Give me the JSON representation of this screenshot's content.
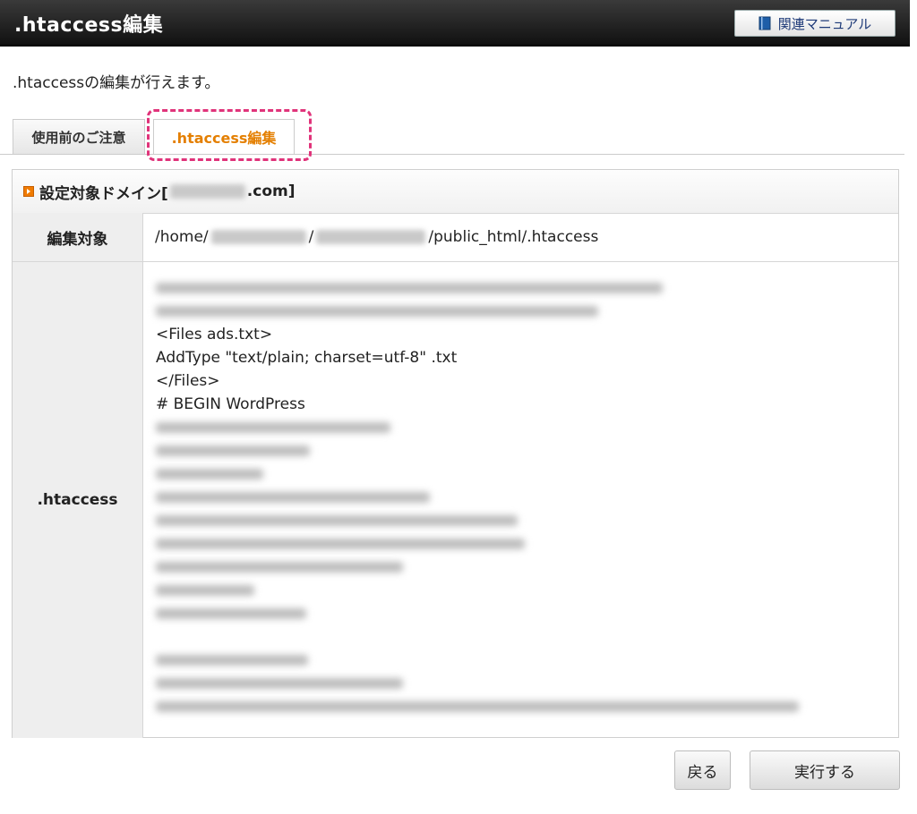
{
  "header": {
    "title": ".htaccess編集",
    "manual_button_label": "関連マニュアル",
    "manual_icon": "book-icon"
  },
  "intro_text": ".htaccessの編集が行えます。",
  "tabs": [
    {
      "label": "使用前のご注意",
      "active": false
    },
    {
      "label": ".htaccess編集",
      "active": true
    }
  ],
  "panel": {
    "heading_prefix": "設定対象ドメイン[",
    "heading_suffix": ".com]",
    "rows": {
      "target_label": "編集対象",
      "path_part1": "/home/",
      "path_part2": "/",
      "path_part3": "/public_html/.htaccess",
      "htaccess_label": ".htaccess"
    },
    "editor_visible_lines": [
      "<Files ads.txt>",
      "AddType \"text/plain; charset=utf-8\" .txt",
      "</Files>",
      "# BEGIN WordPress"
    ]
  },
  "buttons": {
    "back_label": "戻る",
    "run_label": "実行する"
  },
  "colors": {
    "accent": "#e47f00",
    "highlight": "#e0337a",
    "header_bg": "#1a1a1a",
    "manual_text": "#1e3a78"
  }
}
